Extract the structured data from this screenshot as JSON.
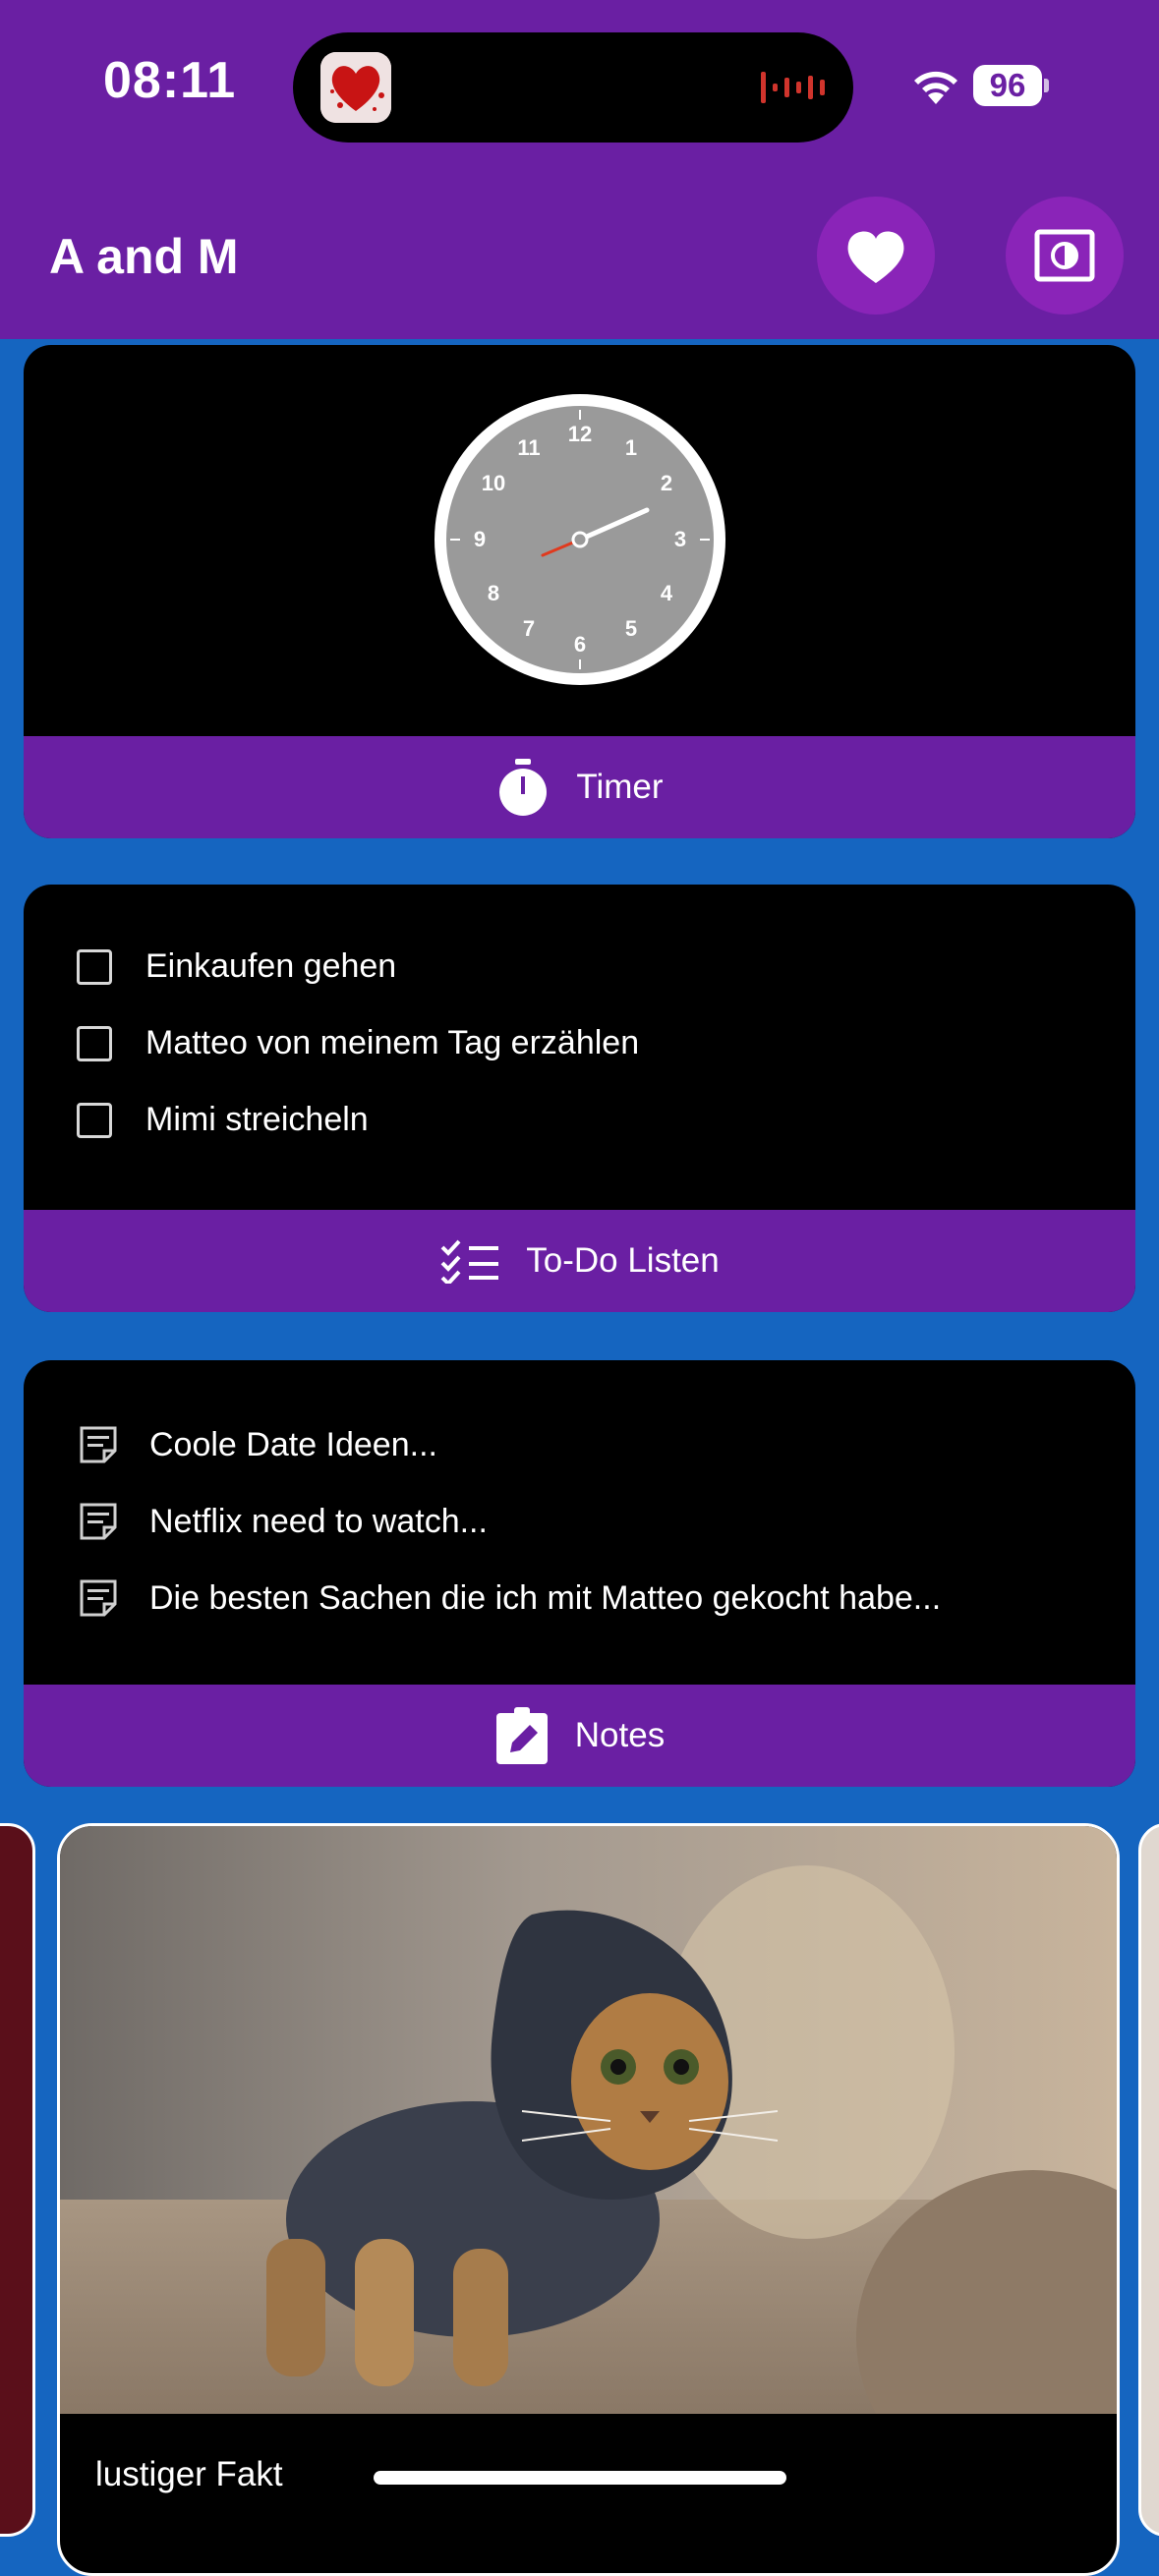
{
  "status_bar": {
    "time": "08:11",
    "battery": "96",
    "icons": [
      "wifi-icon",
      "battery-icon",
      "audio-activity-icon"
    ]
  },
  "app_bar": {
    "title": "A and M",
    "actions": [
      "heart-icon",
      "brightness-icon"
    ]
  },
  "clock_card": {
    "clock_numbers": [
      "12",
      "1",
      "2",
      "3",
      "4",
      "5",
      "6",
      "7",
      "8",
      "9",
      "10",
      "11"
    ],
    "button_label": "Timer",
    "button_icon": "timer-icon"
  },
  "todo_card": {
    "items": [
      {
        "label": "Einkaufen gehen",
        "checked": false
      },
      {
        "label": "Matteo von meinem Tag erzählen",
        "checked": false
      },
      {
        "label": "Mimi streicheln",
        "checked": false
      }
    ],
    "button_label": "To-Do Listen",
    "button_icon": "checklist-icon"
  },
  "notes_card": {
    "items": [
      {
        "label": "Coole Date Ideen..."
      },
      {
        "label": "Netflix need to watch..."
      },
      {
        "label": "Die besten Sachen die ich mit Matteo gekocht habe..."
      }
    ],
    "button_label": "Notes",
    "button_icon": "note-edit-icon"
  },
  "carousel": {
    "current": {
      "caption": "lustiger Fakt"
    }
  },
  "colors": {
    "app_bar": "#6A1FA3",
    "background": "#1565C0",
    "card": "#000000",
    "accent_button": "#8A24B8"
  }
}
